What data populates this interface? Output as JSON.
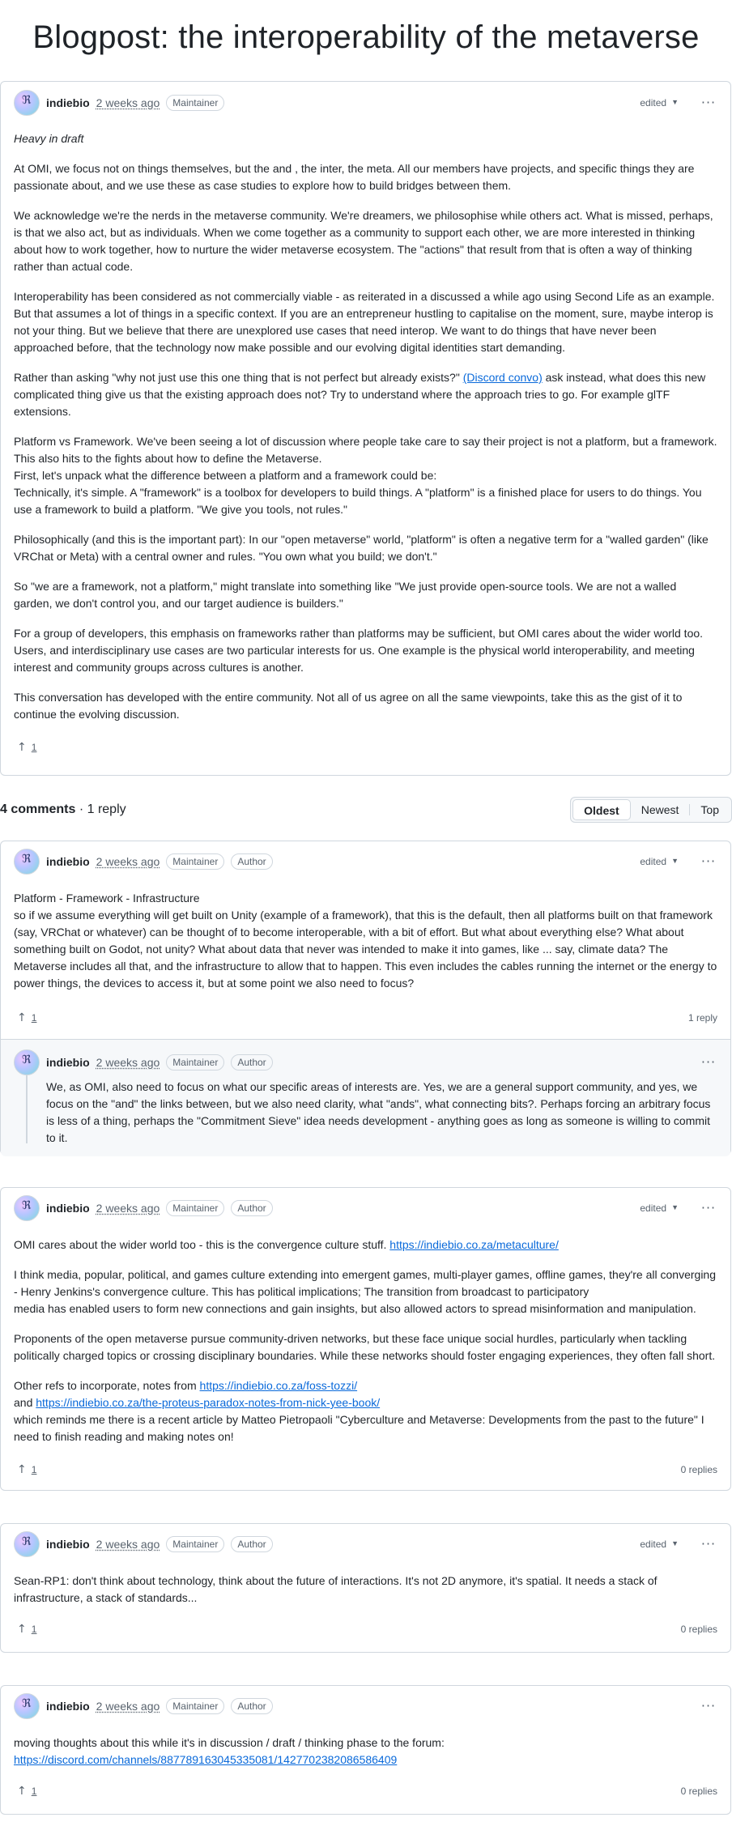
{
  "page": {
    "title": "Blogpost: the interoperability of the metaverse"
  },
  "post": {
    "author": "indiebio",
    "time": "2 weeks ago",
    "badges": [
      "Maintainer"
    ],
    "edited": "edited",
    "upvotes": "1",
    "paragraphs": [
      "Heavy in draft",
      "At OMI, we focus not on things themselves, but the and , the inter, the meta. All our members have projects, and specific things they are passionate about, and we use these as case studies to explore how to build bridges between them.",
      "We acknowledge we're the nerds in the metaverse community. We're dreamers, we philosophise while others act. What is missed, perhaps, is that we also act, but as individuals. When we come together as a community to support each other, we are more interested in thinking about how to work together, how to nurture the wider metaverse ecosystem. The \"actions\" that result from that is often a way of thinking rather than actual code.",
      "Interoperability has been considered as not commercially viable - as reiterated in a discussed a while ago using Second Life as an example. But that assumes a lot of things in a specific context. If you are an entrepreneur hustling to capitalise on the moment, sure, maybe interop is not your thing. But we believe that there are unexplored use cases that need interop. We want to do things that have never been approached before, that the technology now make possible and our evolving digital identities start demanding.",
      "Platform vs Framework. We've been seeing a lot of discussion where people take care to say their project is not a platform, but a framework. This also hits to the fights about how to define the Metaverse.",
      "First, let's unpack what the difference between a platform and a framework could be:",
      "Technically, it's simple. A \"framework\" is a toolbox for developers to build things. A \"platform\" is a finished place for users to do things. You use a framework to build a platform. \"We give you tools, not rules.\"",
      "Philosophically (and this is the important part): In our \"open metaverse\" world, \"platform\" is often a negative term for a \"walled garden\" (like VRChat or Meta) with a central owner and rules. \"You own what you build; we don't.\"",
      "So \"we are a framework, not a platform,\" might translate into something like \"We just provide open-source tools. We are not a walled garden, we don't control you, and our target audience is builders.\"",
      "For a group of developers, this emphasis on frameworks rather than platforms may be sufficient, but OMI cares about the wider world too. Users, and interdisciplinary use cases are two particular interests for us. One example is the physical world interoperability, and meeting interest and community groups across cultures is another.",
      "This conversation has developed with the entire community. Not all of us agree on all the same viewpoints, take this as the gist of it to continue the evolving discussion."
    ],
    "asking_before": "Rather than asking \"why not just use this one thing that is not perfect but already exists?\" ",
    "asking_link": "(Discord convo)",
    "asking_after": " ask instead, what does this new complicated thing give us that the existing approach does not? Try to understand where the approach tries to go. For example glTF extensions."
  },
  "comments_bar": {
    "count": "4 comments",
    "sep": " · ",
    "replies": "1 reply",
    "sort_options": [
      "Oldest",
      "Newest",
      "Top"
    ],
    "active_sort": "Oldest"
  },
  "comments": [
    {
      "author": "indiebio",
      "time": "2 weeks ago",
      "badges": [
        "Maintainer",
        "Author"
      ],
      "edited": "edited",
      "lines": [
        "Platform - Framework - Infrastructure",
        "so if we assume everything will get built on Unity (example of a framework), that this is the default, then all platforms built on that framework (say, VRChat or whatever) can be thought of to become interoperable, with a bit of effort. But what about everything else? What about something built on Godot, not unity? What about data that never was intended to make it into games, like ... say, climate data? The Metaverse includes all that, and the infrastructure to allow that to happen. This even includes the cables running the internet or the energy to power things, the devices to access it, but at some point we also need to focus?"
      ],
      "upvotes": "1",
      "replies_label": "1 reply",
      "reply": {
        "author": "indiebio",
        "time": "2 weeks ago",
        "badges": [
          "Maintainer",
          "Author"
        ],
        "text": "We, as OMI, also need to focus on what our specific areas of interests are. Yes, we are a general support community, and yes, we focus on the \"and\" the links between, but we also need clarity, what \"ands\", what connecting bits?. Perhaps forcing an arbitrary focus is less of a thing, perhaps the \"Commitment Sieve\" idea needs development - anything goes as long as someone is willing to commit to it."
      }
    },
    {
      "author": "indiebio",
      "time": "2 weeks ago",
      "badges": [
        "Maintainer",
        "Author"
      ],
      "edited": "edited",
      "intro": "OMI cares about the wider world too - this is the convergence culture stuff. ",
      "intro_link": "https://indiebio.co.za/metaculture/",
      "p2_a": "I think media, popular, political, and games culture extending into emergent games, multi-player games, offline games, they're all converging - Henry Jenkins's convergence culture. This has political implications; The transition from broadcast to participatory",
      "p2_b": "media has enabled users to form new connections and gain insights, but also allowed actors to spread misinformation and manipulation.",
      "p3": "Proponents of the open metaverse pursue community-driven networks, but these face unique social hurdles, particularly when tackling politically charged topics or crossing disciplinary boundaries. While these networks should foster engaging experiences, they often fall short.",
      "refs_a": "Other refs to incorporate, notes from ",
      "refs_link1": "https://indiebio.co.za/foss-tozzi/",
      "refs_and": "and ",
      "refs_link2": "https://indiebio.co.za/the-proteus-paradox-notes-from-nick-yee-book/",
      "refs_c": "which reminds me there is a recent article by Matteo Pietropaoli \"Cyberculture and Metaverse: Developments from the past to the future\" I need to finish reading and making notes on!",
      "upvotes": "1",
      "replies_label": "0 replies"
    },
    {
      "author": "indiebio",
      "time": "2 weeks ago",
      "badges": [
        "Maintainer",
        "Author"
      ],
      "edited": "edited",
      "text": "Sean-RP1: don't think about technology, think about the future of interactions. It's not 2D anymore, it's spatial. It needs a stack of infrastructure, a stack of standards...",
      "upvotes": "1",
      "replies_label": "0 replies"
    },
    {
      "author": "indiebio",
      "time": "2 weeks ago",
      "badges": [
        "Maintainer",
        "Author"
      ],
      "text": "moving thoughts about this while it's in discussion / draft / thinking phase to the forum:",
      "link": "https://discord.com/channels/887789163045335081/1427702382086586409",
      "upvotes": "1",
      "replies_label": "0 replies"
    }
  ],
  "icons": {
    "avatar_glyph": "ℜ",
    "upvote": "↑",
    "more": "···",
    "caret": "▼"
  }
}
